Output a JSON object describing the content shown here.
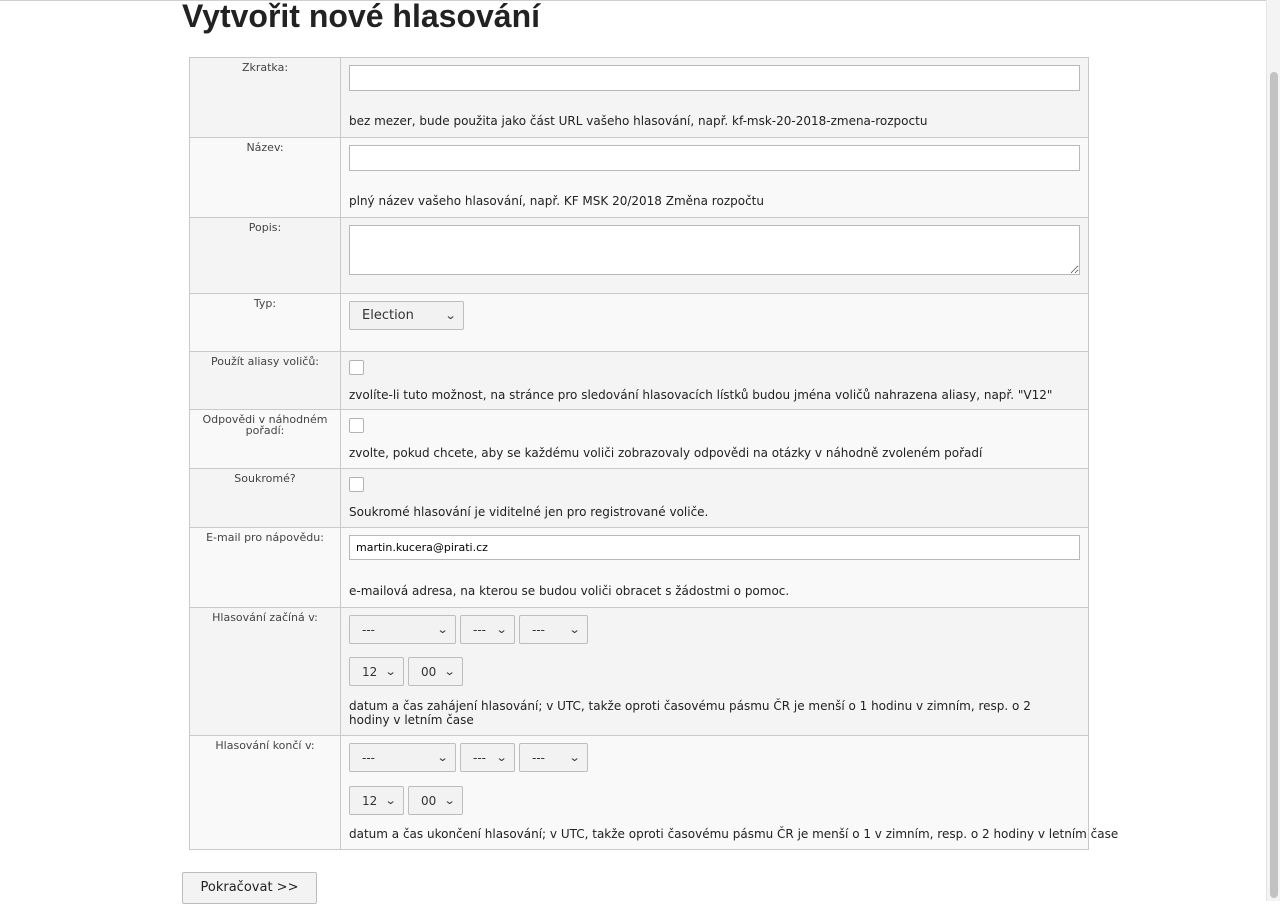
{
  "page": {
    "title": "Vytvořit nové hlasování"
  },
  "fields": {
    "short_name": {
      "label": "Zkratka:",
      "value": "",
      "help": "bez mezer, bude použita jako část URL vašeho hlasování, např. kf-msk-20-2018-zmena-rozpoctu"
    },
    "name": {
      "label": "Název:",
      "value": "",
      "help": "plný název vašeho hlasování, např. KF MSK 20/2018 Změna rozpočtu"
    },
    "description": {
      "label": "Popis:",
      "value": ""
    },
    "type": {
      "label": "Typ:",
      "selected": "Election"
    },
    "use_aliases": {
      "label": "Použít aliasy voličů:",
      "checked": false,
      "help": "zvolíte-li tuto možnost, na stránce pro sledování hlasovacích lístků budou jména voličů nahrazena aliasy, např. \"V12\""
    },
    "randomize": {
      "label": "Odpovědi v náhodném pořadí:",
      "checked": false,
      "help": "zvolte, pokud chcete, aby se každému voliči zobrazovaly odpovědi na otázky v náhodně zvoleném pořadí"
    },
    "private": {
      "label": "Soukromé?",
      "checked": false,
      "help": "Soukromé hlasování je viditelné jen pro registrované voliče."
    },
    "help_email": {
      "label": "E-mail pro nápovědu:",
      "value": "martin.kucera@pirati.cz",
      "help": "e-mailová adresa, na kterou se budou voliči obracet s žádostmi o pomoc."
    },
    "voting_start": {
      "label": "Hlasování začíná v:",
      "date": [
        "---",
        "---",
        "---"
      ],
      "hour": "12",
      "minute": "00",
      "help": "datum a čas zahájení hlasování; v UTC, takže oproti časovému pásmu ČR je menší o 1 hodinu v zimním, resp. o 2 hodiny v letním čase"
    },
    "voting_end": {
      "label": "Hlasování končí v:",
      "date": [
        "---",
        "---",
        "---"
      ],
      "hour": "12",
      "minute": "00",
      "help": "datum a čas ukončení hlasování; v UTC, takže oproti časovému pásmu ČR je menší o 1 v zimním, resp. o 2 hodiny v letním čase"
    }
  },
  "buttons": {
    "continue": "Pokračovat >>"
  },
  "icons": {
    "dropdown": "chevron-down-icon",
    "resize": "resize-handle-icon"
  },
  "colors": {
    "row_odd": "#f4f4f4",
    "row_even": "#f9f9f9",
    "border": "#c9c9c9"
  }
}
